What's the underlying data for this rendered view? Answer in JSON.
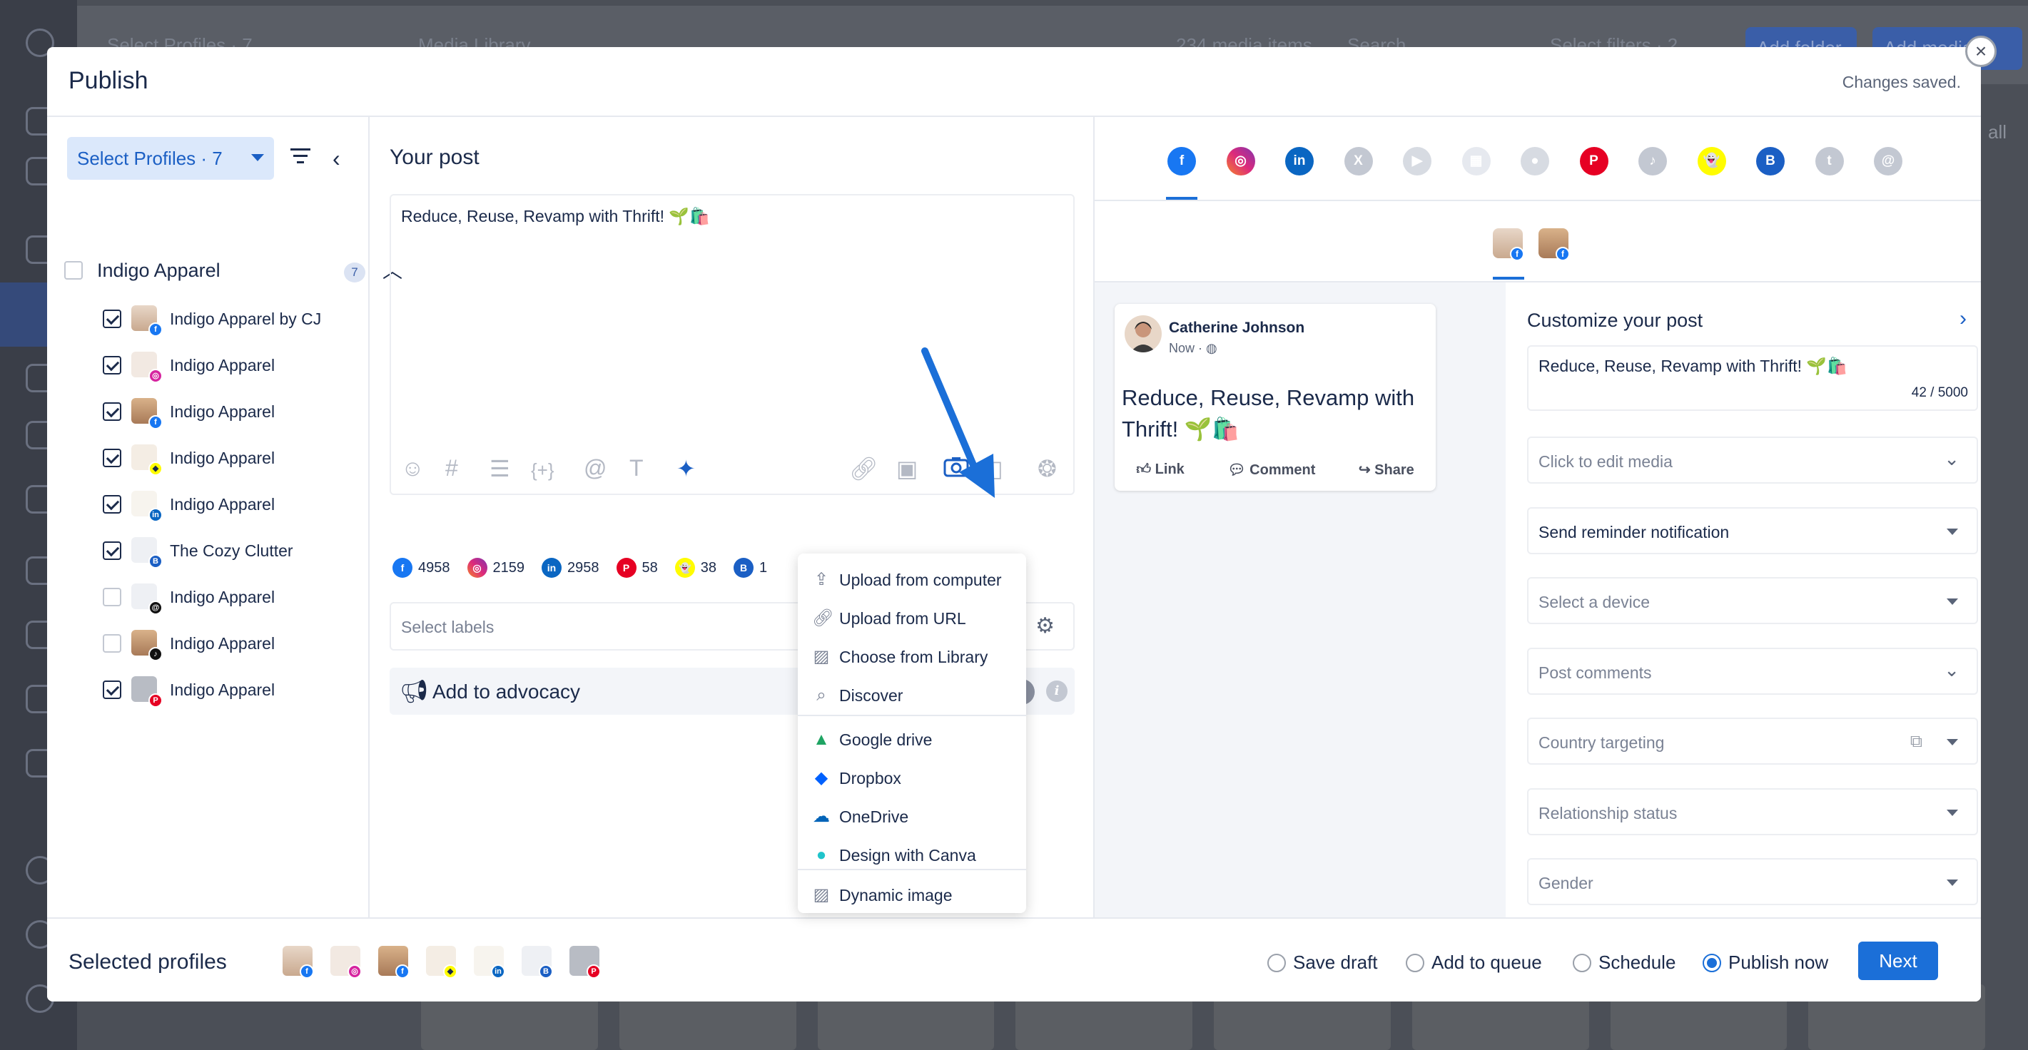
{
  "modal": {
    "title": "Publish",
    "status": "Changes saved."
  },
  "background": {
    "select_profiles": "Select Profiles · 7",
    "page_title": "Media Library",
    "media_count": "234 media items",
    "search_placeholder": "Search",
    "select_filters": "Select filters · 2",
    "add_folder": "Add folder",
    "add_media": "Add media",
    "all_label": "all"
  },
  "left_panel": {
    "select_profiles_label": "Select Profiles · 7",
    "group": {
      "name": "Indigo Apparel",
      "count": "7"
    },
    "profiles": [
      {
        "name": "Indigo Apparel by CJ",
        "checked": true,
        "network": "facebook",
        "icon": "facebook-badge-icon"
      },
      {
        "name": "Indigo Apparel",
        "checked": true,
        "network": "instagram",
        "icon": "instagram-badge-icon"
      },
      {
        "name": "Indigo Apparel",
        "checked": true,
        "network": "facebook",
        "icon": "facebook-badge-icon"
      },
      {
        "name": "Indigo Apparel",
        "checked": true,
        "network": "snapchat",
        "icon": "snapchat-badge-icon"
      },
      {
        "name": "Indigo Apparel",
        "checked": true,
        "network": "linkedin",
        "icon": "linkedin-badge-icon"
      },
      {
        "name": "The Cozy Clutter",
        "checked": true,
        "network": "google-business",
        "icon": "google-business-badge-icon"
      },
      {
        "name": "Indigo Apparel",
        "checked": false,
        "network": "threads",
        "icon": "threads-badge-icon"
      },
      {
        "name": "Indigo Apparel",
        "checked": false,
        "network": "tiktok",
        "icon": "tiktok-badge-icon"
      },
      {
        "name": "Indigo Apparel",
        "checked": true,
        "network": "pinterest",
        "icon": "pinterest-badge-icon"
      }
    ]
  },
  "composer": {
    "title": "Your post",
    "text": "Reduce, Reuse, Revamp with Thrift! 🌱🛍️",
    "toolbar_icons": [
      "emoji-icon",
      "hashtag-icon",
      "template-icon",
      "variable-icon",
      "mention-icon",
      "text-format-icon",
      "ai-wand-icon",
      "link-icon",
      "video-icon",
      "camera-icon",
      "document-icon",
      "color-icon"
    ],
    "char_counts": [
      {
        "network": "facebook",
        "value": "4958"
      },
      {
        "network": "instagram",
        "value": "2159"
      },
      {
        "network": "linkedin",
        "value": "2958"
      },
      {
        "network": "pinterest",
        "value": "58"
      },
      {
        "network": "snapchat",
        "value": "38"
      },
      {
        "network": "google-business",
        "value": "1"
      }
    ],
    "labels_placeholder": "Select labels",
    "advocacy_label": "Add to advocacy",
    "advocacy_enabled": false
  },
  "media_menu": {
    "items": [
      {
        "label": "Upload from computer",
        "icon": "upload-icon"
      },
      {
        "label": "Upload from URL",
        "icon": "link-icon"
      },
      {
        "label": "Choose from Library",
        "icon": "image-icon"
      },
      {
        "label": "Discover",
        "icon": "search-icon"
      },
      {
        "label": "Google drive",
        "icon": "google-drive-icon"
      },
      {
        "label": "Dropbox",
        "icon": "dropbox-icon"
      },
      {
        "label": "OneDrive",
        "icon": "onedrive-icon"
      },
      {
        "label": "Design with Canva",
        "icon": "canva-icon"
      },
      {
        "label": "Dynamic image",
        "icon": "image-icon"
      }
    ]
  },
  "network_tabs": [
    "facebook",
    "instagram",
    "linkedin",
    "x",
    "youtube",
    "google-my-business",
    "reddit",
    "pinterest",
    "tiktok",
    "snapchat",
    "google-business",
    "tumblr",
    "threads"
  ],
  "preview": {
    "author": "Catherine Johnson",
    "time": "Now · ◍",
    "text": "Reduce, Reuse, Revamp with Thrift! 🌱🛍️",
    "actions": [
      "Link",
      "Comment",
      "Share"
    ]
  },
  "customize": {
    "title": "Customize your post",
    "text": "Reduce, Reuse, Revamp with Thrift! 🌱🛍️",
    "char_count": "42 / 5000",
    "fields": [
      {
        "label": "Click to edit media",
        "muted": true,
        "control": "chevron"
      },
      {
        "label": "Send reminder notification",
        "muted": false,
        "control": "caret"
      },
      {
        "label": "Select a device",
        "muted": true,
        "control": "caret"
      },
      {
        "label": "Post comments",
        "muted": true,
        "control": "chevron"
      },
      {
        "label": "Country targeting",
        "muted": true,
        "control": "caret"
      },
      {
        "label": "Relationship status",
        "muted": true,
        "control": "caret"
      },
      {
        "label": "Gender",
        "muted": true,
        "control": "caret"
      }
    ]
  },
  "footer": {
    "selected_profiles_label": "Selected profiles",
    "options": [
      {
        "label": "Save draft",
        "selected": false
      },
      {
        "label": "Add to queue",
        "selected": false
      },
      {
        "label": "Schedule",
        "selected": false
      },
      {
        "label": "Publish now",
        "selected": true
      }
    ],
    "next_label": "Next"
  },
  "colors": {
    "accent": "#1b6fd8",
    "facebook": "#1877f2",
    "instagram": "#d6249f",
    "linkedin": "#0a66c2",
    "pinterest": "#e60023",
    "snapchat": "#fffc00"
  }
}
